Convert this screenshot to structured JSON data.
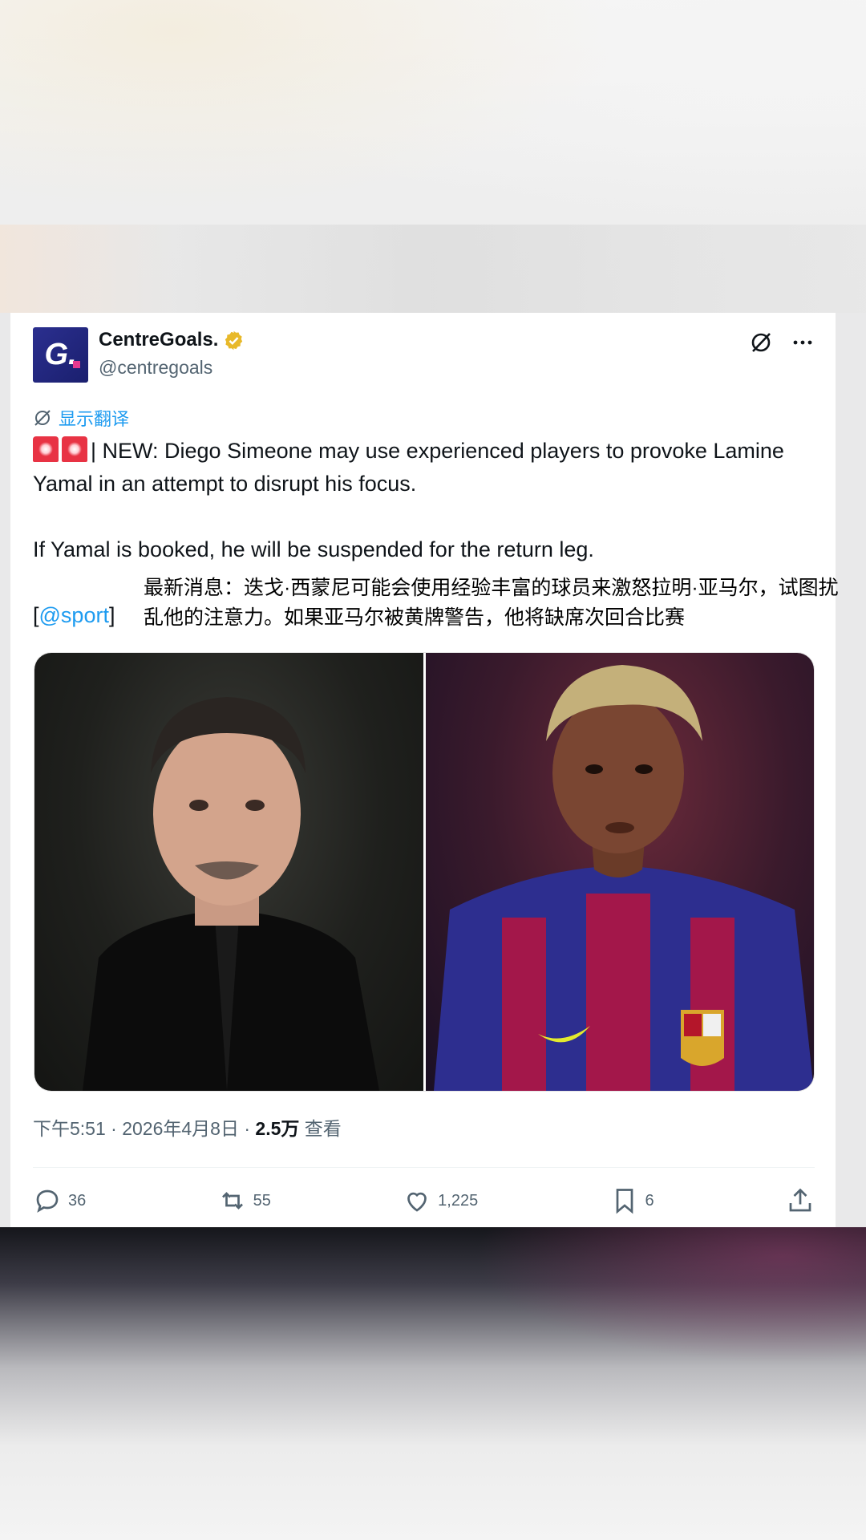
{
  "tweet": {
    "author": {
      "display_name": "CentreGoals.",
      "handle": "@centregoals",
      "avatar_letter": "G."
    },
    "translate_label": "显示翻译",
    "text_line1": "| NEW: Diego Simeone may use experienced players to provoke Lamine Yamal in an attempt to disrupt his focus.",
    "text_line2": "If Yamal is booked, he will be suspended for the return leg.",
    "mention_open": "[",
    "mention": "@sport",
    "mention_close": "]",
    "translation_overlay": "最新消息：迭戈·西蒙尼可能会使用经验丰富的球员来激怒拉明·亚马尔，试图扰乱他的注意力。如果亚马尔被黄牌警告，他将缺席次回合比赛",
    "meta": {
      "time_date": "下午5:51 · 2026年4月8日 · ",
      "views_count": "2.5万",
      "views_label": " 查看"
    },
    "stats": {
      "replies": "36",
      "reposts": "55",
      "likes": "1,225",
      "bookmarks": "6"
    }
  },
  "colors": {
    "accent": "#1d9bf0",
    "text": "#0f1419",
    "muted": "#536471",
    "verified_gold": "#e8b92a"
  }
}
